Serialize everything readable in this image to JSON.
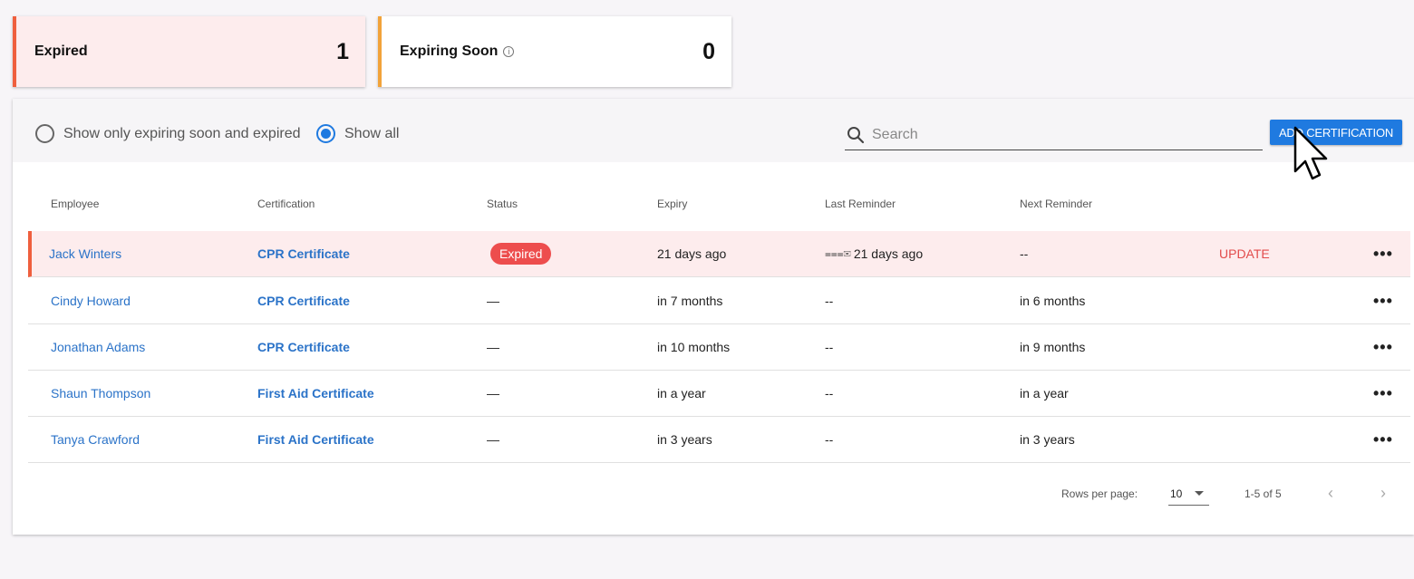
{
  "cards": {
    "expired": {
      "label": "Expired",
      "count": "1",
      "accent": "#ef5f3e"
    },
    "expiring": {
      "label": "Expiring Soon",
      "count": "0",
      "accent": "#f2a33a",
      "info_icon": "info-icon"
    }
  },
  "filters": {
    "option1": "Show only expiring soon and expired",
    "option2": "Show all",
    "selected": "Show all"
  },
  "search": {
    "placeholder": "Search",
    "value": ""
  },
  "toolbar": {
    "add_label": "ADD CERTIFICATION"
  },
  "table": {
    "headers": [
      "Employee",
      "Certification",
      "Status",
      "Expiry",
      "Last Reminder",
      "Next Reminder"
    ],
    "rows": [
      {
        "employee": "Jack Winters",
        "certification": "CPR Certificate",
        "status": "Expired",
        "expiry": "21 days ago",
        "last_reminder": "21 days ago",
        "next_reminder": "--",
        "action": "UPDATE"
      },
      {
        "employee": "Cindy Howard",
        "certification": "CPR Certificate",
        "status": "—",
        "expiry": "in 7 months",
        "last_reminder": "--",
        "next_reminder": "in 6 months"
      },
      {
        "employee": "Jonathan Adams",
        "certification": "CPR Certificate",
        "status": "—",
        "expiry": "in 10 months",
        "last_reminder": "--",
        "next_reminder": "in 9 months"
      },
      {
        "employee": "Shaun Thompson",
        "certification": "First Aid Certificate",
        "status": "—",
        "expiry": "in a year",
        "last_reminder": "--",
        "next_reminder": "in a year"
      },
      {
        "employee": "Tanya Crawford",
        "certification": "First Aid Certificate",
        "status": "—",
        "expiry": "in 3 years",
        "last_reminder": "--",
        "next_reminder": "in 3 years"
      }
    ],
    "more_label": "•••"
  },
  "pagination": {
    "rows_per_page_label": "Rows per page:",
    "rows_per_page": "10",
    "range": "1-5 of 5",
    "prev": "‹",
    "next": "›"
  },
  "colors": {
    "accent": "#1f7ae0",
    "expired": "#ed4d4d",
    "link": "#2b73c8"
  }
}
